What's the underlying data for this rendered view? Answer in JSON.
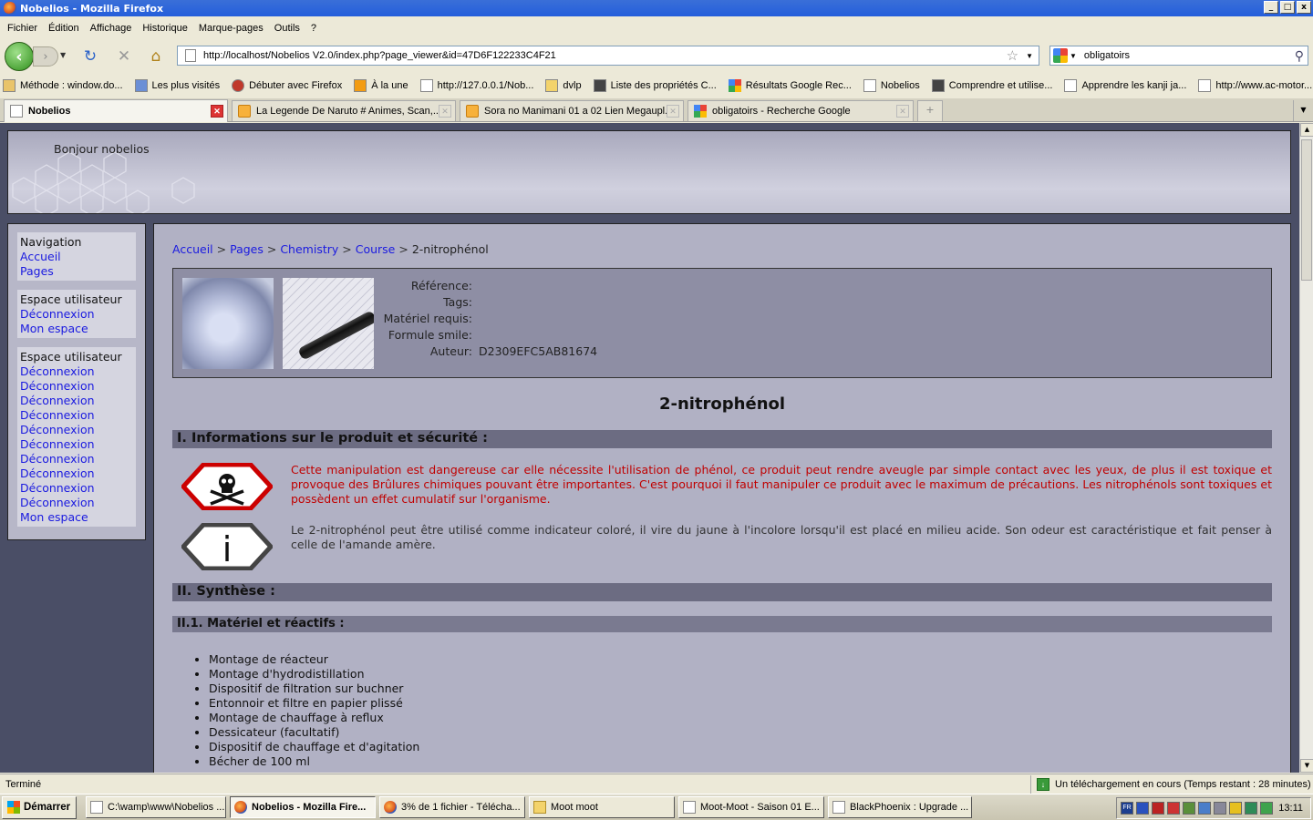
{
  "window": {
    "title": "Nobelios - Mozilla Firefox",
    "controls": [
      "_",
      "□",
      "x"
    ]
  },
  "menu": [
    "Fichier",
    "Édition",
    "Affichage",
    "Historique",
    "Marque-pages",
    "Outils",
    "?"
  ],
  "navbar": {
    "url": "http://localhost/Nobelios V2.0/index.php?page_viewer&id=47D6F122233C4F21",
    "search_value": "obligatoirs"
  },
  "bookmarks": [
    {
      "label": "Méthode : window.do...",
      "icon": "js-icon"
    },
    {
      "label": "Les plus visités",
      "icon": "folder-icon"
    },
    {
      "label": "Débuter avec Firefox",
      "icon": "firefox-icon"
    },
    {
      "label": "À la une",
      "icon": "rss-icon"
    },
    {
      "label": "http://127.0.0.1/Nob...",
      "icon": "page-icon"
    },
    {
      "label": "dvlp",
      "icon": "folder-icon"
    },
    {
      "label": "Liste des propriétés C...",
      "icon": "hat-icon"
    },
    {
      "label": "Résultats Google Rec...",
      "icon": "google-icon"
    },
    {
      "label": "Nobelios",
      "icon": "page-icon"
    },
    {
      "label": "Comprendre et utilise...",
      "icon": "hat-icon"
    },
    {
      "label": "Apprendre les kanji ja...",
      "icon": "page-icon"
    },
    {
      "label": "http://www.ac-motor...",
      "icon": "page-icon"
    }
  ],
  "tabs": [
    {
      "title": "Nobelios",
      "active": true
    },
    {
      "title": "La Legende De Naruto # Animes, Scan,...",
      "active": false
    },
    {
      "title": "Sora no Manimani 01 a 02 Lien Megaupl...",
      "active": false
    },
    {
      "title": "obligatoirs - Recherche Google",
      "active": false
    }
  ],
  "page": {
    "greeting": "Bonjour nobelios",
    "sidebar": [
      {
        "heading": "Navigation",
        "links": [
          "Accueil",
          "Pages"
        ]
      },
      {
        "heading": "Espace utilisateur",
        "links": [
          "Déconnexion",
          "Mon espace"
        ]
      },
      {
        "heading": "Espace utilisateur",
        "links": [
          "Déconnexion",
          "Déconnexion",
          "Déconnexion",
          "Déconnexion",
          "Déconnexion",
          "Déconnexion",
          "Déconnexion",
          "Déconnexion",
          "Déconnexion",
          "Déconnexion",
          "Mon espace"
        ]
      }
    ],
    "breadcrumb": {
      "links": [
        "Accueil",
        "Pages",
        "Chemistry",
        "Course"
      ],
      "separator": ">",
      "current": "2-nitrophénol"
    },
    "meta": [
      {
        "key": "Référence:",
        "value": ""
      },
      {
        "key": "Tags:",
        "value": ""
      },
      {
        "key": "Matériel requis:",
        "value": ""
      },
      {
        "key": "Formule smile:",
        "value": ""
      },
      {
        "key": "Auteur:",
        "value": "D2309EFC5AB81674"
      }
    ],
    "title": "2-nitrophénol",
    "section1": "I. Informations sur le produit et sécurité :",
    "danger_text": "Cette manipulation est dangereuse car elle nécessite l'utilisation de phénol, ce produit peut rendre aveugle par simple contact avec les yeux, de plus il est toxique et provoque des Brûlures chimiques pouvant être importantes. C'est pourquoi il faut manipuler ce produit avec le maximum de précautions. Les nitrophénols sont toxiques et possèdent un effet cumulatif sur l'organisme.",
    "info_text": "Le 2-nitrophénol peut être utilisé comme indicateur coloré, il vire du jaune à l'incolore lorsqu'il est placé en milieu acide. Son odeur est caractéristique et fait penser à celle de l'amande amère.",
    "info_glyph": "i",
    "section2": "II. Synthèse :",
    "subsection": "II.1. Matériel et réactifs :",
    "materials": [
      "Montage de réacteur",
      "Montage d'hydrodistillation",
      "Dispositif de filtration sur buchner",
      "Entonnoir et filtre en papier plissé",
      "Montage de chauffage à reflux",
      "Dessicateur (facultatif)",
      "Dispositif de chauffage et d'agitation",
      "Bécher de 100 ml"
    ]
  },
  "status": {
    "left": "Terminé",
    "download": "Un téléchargement en cours (Temps restant : 28 minutes)"
  },
  "taskbar": {
    "start": "Démarrer",
    "tasks": [
      {
        "label": "C:\\wamp\\www\\Nobelios ...",
        "icon": "notepad",
        "active": false
      },
      {
        "label": "Nobelios - Mozilla Fire...",
        "icon": "firefox",
        "active": true
      },
      {
        "label": "3% de 1 fichier - Télécha...",
        "icon": "firefox",
        "active": false
      },
      {
        "label": "Moot moot",
        "icon": "folder",
        "active": false
      },
      {
        "label": "Moot-Moot - Saison 01 E...",
        "icon": "page",
        "active": false
      },
      {
        "label": "BlackPhoenix : Upgrade ...",
        "icon": "page",
        "active": false
      }
    ],
    "lang": "FR",
    "clock": "13:11"
  },
  "colors": {
    "link": "#1a1ae0",
    "danger_text": "#c00000",
    "section_bar": "#6c6c82",
    "content_bg": "#b1b1c4"
  }
}
